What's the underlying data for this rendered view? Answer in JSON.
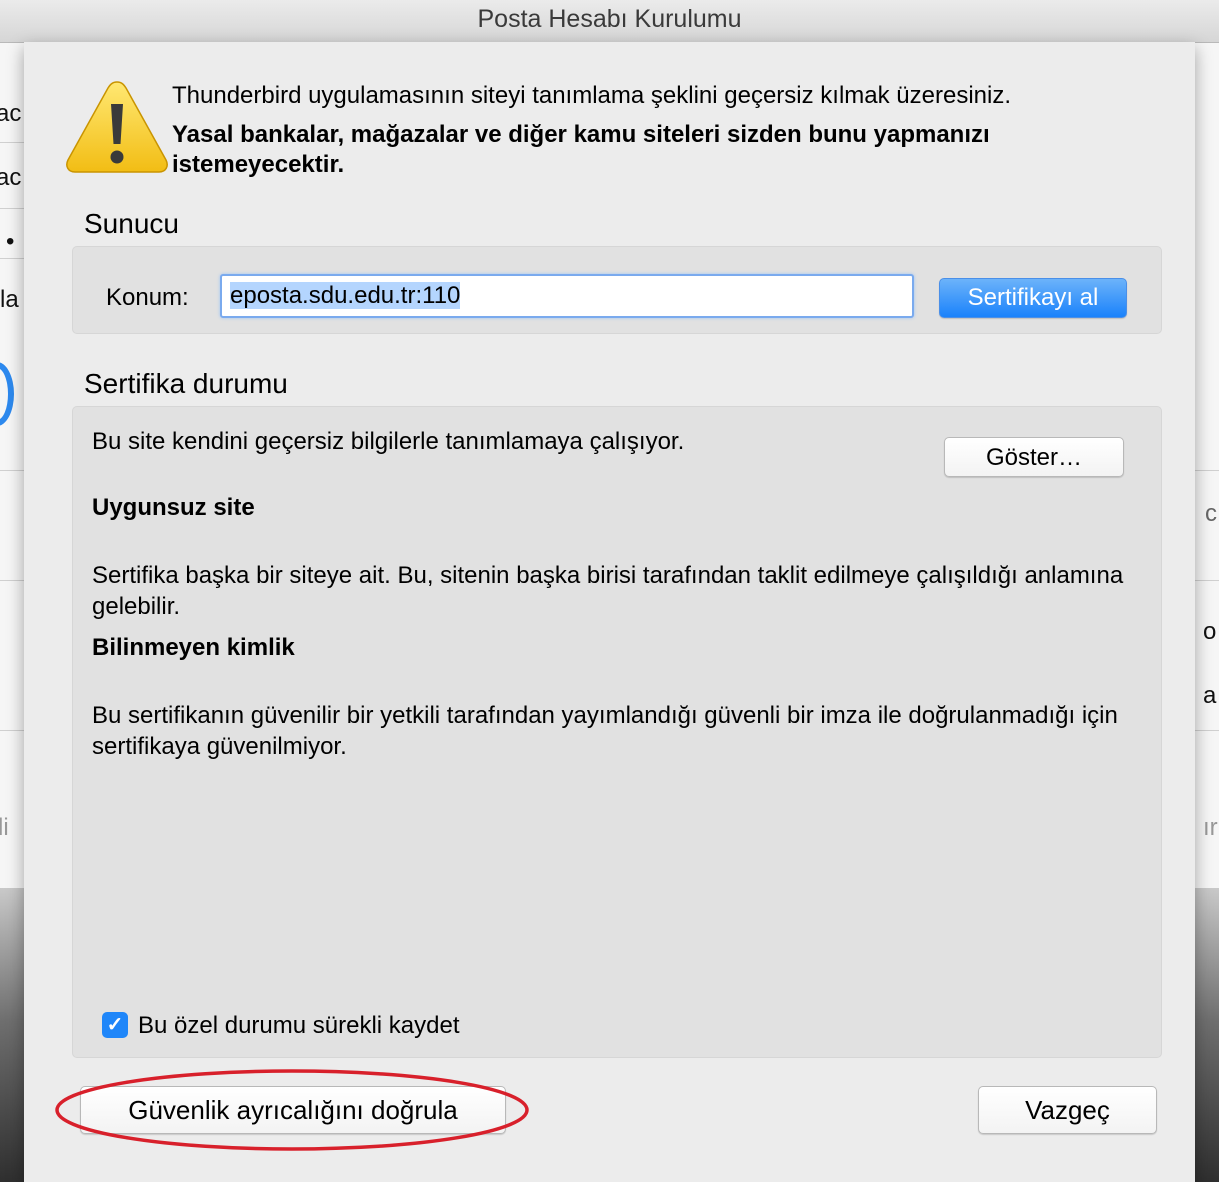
{
  "window": {
    "title": "Posta Hesabı Kurulumu"
  },
  "warning": {
    "line1": "Thunderbird uygulamasının siteyi tanımlama şeklini geçersiz kılmak üzeresiniz.",
    "line2": "Yasal bankalar, mağazalar ve diğer kamu siteleri sizden bunu yapmanızı istemeyecektir.",
    "icon": "warning-triangle"
  },
  "server": {
    "section_title": "Sunucu",
    "location_label": "Konum:",
    "location_value": "eposta.sdu.edu.tr:110",
    "get_certificate_button": "Sertifikayı al"
  },
  "certificate": {
    "section_title": "Sertifika durumu",
    "summary": "Bu site kendini geçersiz bilgilerle tanımlamaya çalışıyor.",
    "show_button": "Göster…",
    "issues": [
      {
        "title": "Uygunsuz site",
        "description": "Sertifika başka bir siteye ait. Bu, sitenin başka birisi tarafından taklit edilmeye çalışıldığı anlamına gelebilir."
      },
      {
        "title": "Bilinmeyen kimlik",
        "description": "Bu sertifikanın güvenilir bir yetkili tarafından yayımlandığı güvenli bir imza ile doğrulanmadığı için sertifikaya güvenilmiyor."
      }
    ],
    "permanent_checkbox": {
      "label": "Bu özel durumu sürekli kaydet",
      "checked": true
    }
  },
  "actions": {
    "confirm_button": "Güvenlik ayrıcalığını doğrula",
    "cancel_button": "Vazgeç"
  },
  "background_fragments": {
    "left": [
      "ac",
      "ac",
      "•",
      "la",
      "li"
    ],
    "right": [
      "c",
      "o",
      "a",
      "ır"
    ]
  },
  "colors": {
    "accent_blue": "#1f86f9",
    "annotation_red": "#d8202b",
    "panel_gray": "#e1e1e1",
    "sheet_gray": "#ececec"
  }
}
